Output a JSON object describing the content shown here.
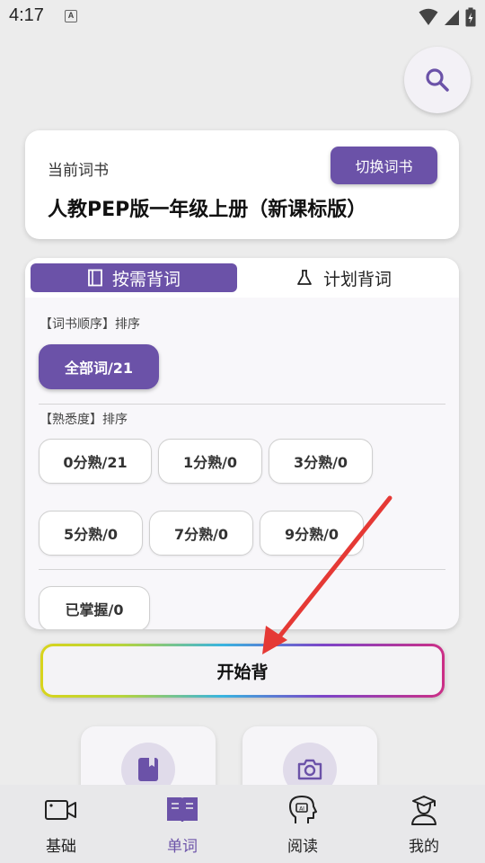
{
  "status": {
    "time": "4:17",
    "notification_badge": "A"
  },
  "search": {
    "icon": "search-icon"
  },
  "book": {
    "label": "当前词书",
    "switch_label": "切换词书",
    "title": "人教PEP版一年级上册（新课标版）"
  },
  "tabs": [
    {
      "label": "按需背词",
      "icon": "book-icon",
      "active": true
    },
    {
      "label": "计划背词",
      "icon": "flask-icon",
      "active": false
    }
  ],
  "sections": {
    "order_label": "【词书顺序】排序",
    "familiarity_label": "【熟悉度】排序"
  },
  "order_chips": [
    {
      "label": "全部词/21",
      "active": true
    }
  ],
  "familiarity_chips": [
    {
      "label": "0分熟/21"
    },
    {
      "label": "1分熟/0"
    },
    {
      "label": "3分熟/0"
    },
    {
      "label": "5分熟/0"
    },
    {
      "label": "7分熟/0"
    },
    {
      "label": "9分熟/0"
    }
  ],
  "mastered_chip": {
    "label": "已掌握/0"
  },
  "start_button": {
    "label": "开始背"
  },
  "tools": [
    {
      "icon": "bookmark-book-icon"
    },
    {
      "icon": "camera-icon"
    }
  ],
  "nav": [
    {
      "label": "基础",
      "icon": "video-icon",
      "active": false
    },
    {
      "label": "单词",
      "icon": "open-book-icon",
      "active": true
    },
    {
      "label": "阅读",
      "icon": "ai-head-icon",
      "active": false
    },
    {
      "label": "我的",
      "icon": "user-graduate-icon",
      "active": false
    }
  ],
  "colors": {
    "accent": "#6b52a8",
    "arrow": "#e53935",
    "background": "#ececec"
  }
}
